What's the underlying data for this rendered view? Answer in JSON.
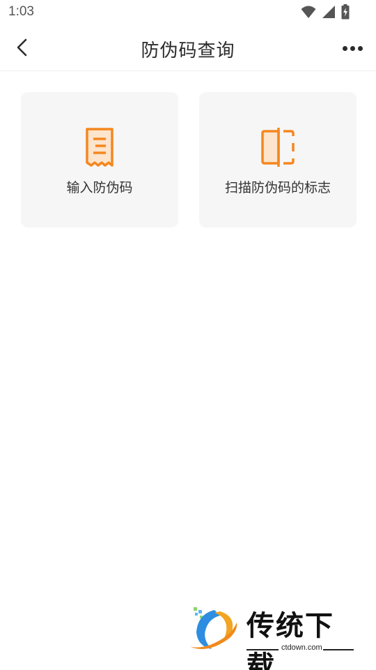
{
  "status_bar": {
    "time": "1:03",
    "icons": [
      "wifi-icon",
      "cell-signal-icon",
      "battery-charging-icon"
    ]
  },
  "app_bar": {
    "title": "防伪码查询",
    "back_icon": "chevron-left-icon",
    "more_icon": "more-horizontal-icon"
  },
  "options": [
    {
      "label": "输入防伪码",
      "icon": "receipt-icon"
    },
    {
      "label": "扫描防伪码的标志",
      "icon": "scan-frame-icon"
    }
  ],
  "watermark": {
    "title": "传统下载",
    "url": "ctdown.com"
  },
  "colors": {
    "accent": "#f5871f",
    "accent_light": "#fde4cc",
    "card_bg": "#f6f6f6",
    "text": "#333333"
  }
}
